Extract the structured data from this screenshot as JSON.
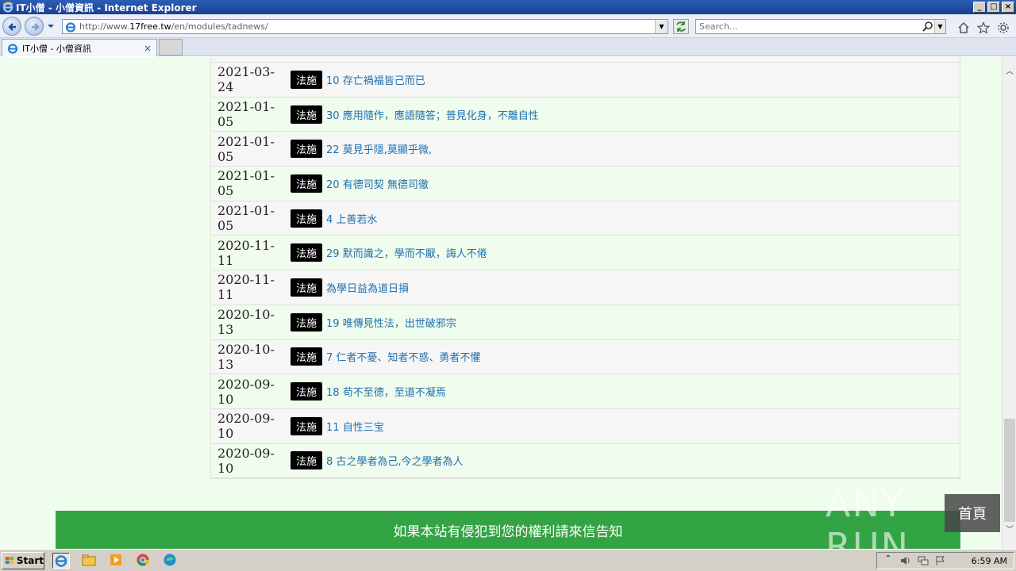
{
  "window": {
    "title": "IT小僧 - 小僧資訊 - Internet Explorer",
    "controls": [
      "_",
      "□",
      "×"
    ]
  },
  "address_bar": {
    "url_prefix": "http://www.",
    "url_domain": "17free.tw",
    "url_path": "/en/modules/tadnews/"
  },
  "search": {
    "placeholder": "Search..."
  },
  "tabs": [
    {
      "label": "IT小僧 - 小僧資訊"
    }
  ],
  "news": {
    "items": [
      {
        "date": "2021-03-24",
        "category": "法施",
        "title": "10 存亡禍福皆己而已"
      },
      {
        "date": "2021-01-05",
        "category": "法施",
        "title": "30 應用隨作，應語隨答；普見化身，不離自性"
      },
      {
        "date": "2021-01-05",
        "category": "法施",
        "title": "22 莫見乎隱,莫顯乎微,"
      },
      {
        "date": "2021-01-05",
        "category": "法施",
        "title": "20 有德司契 無德司徹"
      },
      {
        "date": "2021-01-05",
        "category": "法施",
        "title": "4 上善若水"
      },
      {
        "date": "2020-11-11",
        "category": "法施",
        "title": "29 默而識之，學而不厭，誨人不倦"
      },
      {
        "date": "2020-11-11",
        "category": "法施",
        "title": "為學日益為道日損"
      },
      {
        "date": "2020-10-13",
        "category": "法施",
        "title": "19 唯傳見性法，出世破邪宗"
      },
      {
        "date": "2020-10-13",
        "category": "法施",
        "title": "7 仁者不憂、知者不惑、勇者不懼"
      },
      {
        "date": "2020-09-10",
        "category": "法施",
        "title": "18 苟不至德，至道不凝焉"
      },
      {
        "date": "2020-09-10",
        "category": "法施",
        "title": "11 自性三宝"
      },
      {
        "date": "2020-09-10",
        "category": "法施",
        "title": "8 古之學者為己,今之學者為人"
      }
    ]
  },
  "footer": {
    "notice": "如果本站有侵犯到您的權利請來信告知"
  },
  "home_button": {
    "label": "首頁"
  },
  "watermark": {
    "text": "ANY RUN"
  },
  "taskbar": {
    "start_label": "Start",
    "clock": "6:59 AM"
  },
  "colors": {
    "page_bg": "#effded",
    "footer_bg": "#33a444",
    "link": "#1f6fb0",
    "category_bg": "#000000"
  }
}
